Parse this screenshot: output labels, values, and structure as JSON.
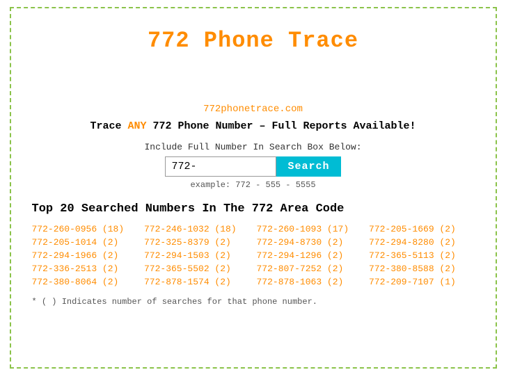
{
  "page": {
    "title": "772 Phone Trace",
    "site_url": "772phonetrace.com",
    "tagline_prefix": "Trace ",
    "tagline_any": "ANY",
    "tagline_suffix": " 772 Phone Number – Full Reports Available!",
    "search_label": "Include Full Number In Search Box Below:",
    "search_placeholder": "772-",
    "search_value": "772-",
    "search_button": "Search",
    "search_example": "example: 772 - 555 - 5555",
    "section_title": "Top 20 Searched Numbers In The 772 Area Code",
    "footnote": "* ( ) Indicates number of searches for that phone number."
  },
  "numbers": [
    {
      "text": "772-260-0956 (18)",
      "href": "#"
    },
    {
      "text": "772-246-1032 (18)",
      "href": "#"
    },
    {
      "text": "772-260-1093 (17)",
      "href": "#"
    },
    {
      "text": "772-205-1669 (2)",
      "href": "#"
    },
    {
      "text": "772-205-1014 (2)",
      "href": "#"
    },
    {
      "text": "772-325-8379 (2)",
      "href": "#"
    },
    {
      "text": "772-294-8730 (2)",
      "href": "#"
    },
    {
      "text": "772-294-8280 (2)",
      "href": "#"
    },
    {
      "text": "772-294-1966 (2)",
      "href": "#"
    },
    {
      "text": "772-294-1503 (2)",
      "href": "#"
    },
    {
      "text": "772-294-1296 (2)",
      "href": "#"
    },
    {
      "text": "772-365-5113 (2)",
      "href": "#"
    },
    {
      "text": "772-336-2513 (2)",
      "href": "#"
    },
    {
      "text": "772-365-5502 (2)",
      "href": "#"
    },
    {
      "text": "772-807-7252 (2)",
      "href": "#"
    },
    {
      "text": "772-380-8588 (2)",
      "href": "#"
    },
    {
      "text": "772-380-8064 (2)",
      "href": "#"
    },
    {
      "text": "772-878-1574 (2)",
      "href": "#"
    },
    {
      "text": "772-878-1063 (2)",
      "href": "#"
    },
    {
      "text": "772-209-7107 (1)",
      "href": "#"
    }
  ]
}
